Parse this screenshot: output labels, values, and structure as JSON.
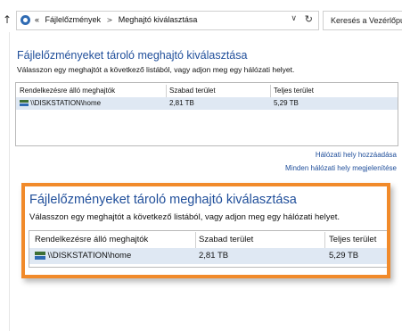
{
  "address_bar": {
    "breadcrumb": [
      "«",
      "Fájlelőzmények",
      "Meghajtó kiválasztása"
    ],
    "search_placeholder": "Keresés a Vezérlőpult"
  },
  "background_panel": {
    "title": "Fájlelőzményeket tároló meghajtó kiválasztása",
    "description": "Válasszon egy meghajtót a következő listából, vagy adjon meg egy hálózati helyet.",
    "columns": [
      "Rendelkezésre álló meghajtók",
      "Szabad terület",
      "Teljes terület"
    ],
    "rows": [
      {
        "drive": "\\\\DISKSTATION\\home",
        "free": "2,81 TB",
        "total": "5,29 TB"
      }
    ],
    "links": {
      "add_network_location": "Hálózati hely hozzáadása",
      "show_all_network_locations": "Minden hálózati hely megjelenítése"
    }
  },
  "magnified_panel": {
    "title": "Fájlelőzményeket tároló meghajtó kiválasztása",
    "description": "Válasszon egy meghajtót a következő listából, vagy adjon meg egy hálózati helyet.",
    "columns": [
      "Rendelkezésre álló meghajtók",
      "Szabad terület",
      "Teljes terület"
    ],
    "rows": [
      {
        "drive": "\\\\DISKSTATION\\home",
        "free": "2,81 TB",
        "total": "5,29 TB"
      }
    ]
  },
  "colors": {
    "accent_blue": "#1f4e9a",
    "callout_orange": "#f18a2a",
    "selected_row": "#dfe8f3"
  },
  "icons": [
    "up-arrow-icon",
    "control-panel-icon",
    "chevron-down-icon",
    "refresh-icon",
    "network-drive-icon"
  ]
}
